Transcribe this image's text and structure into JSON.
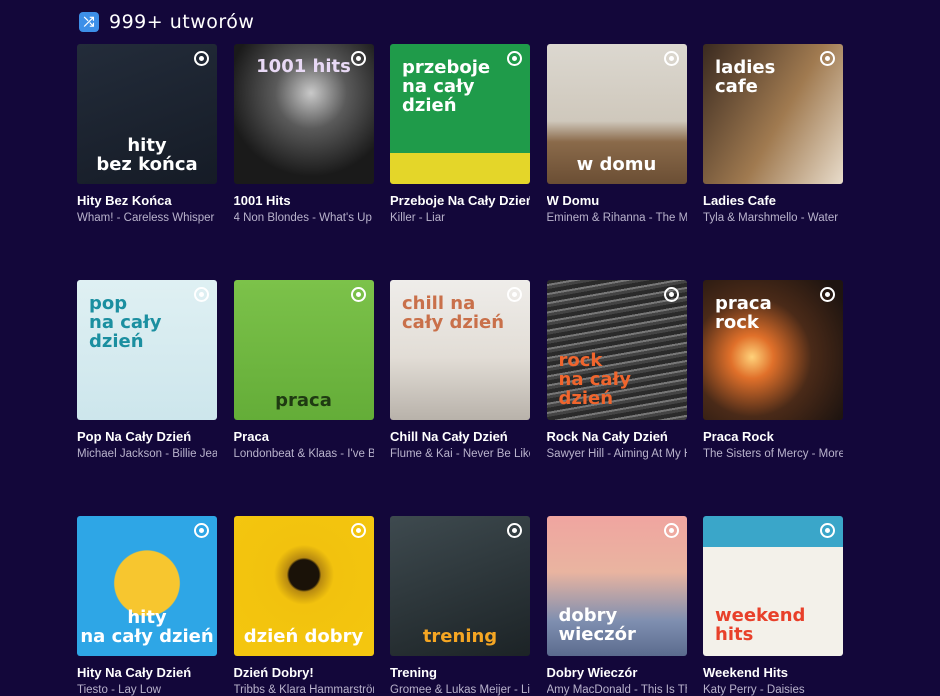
{
  "header": {
    "icon": "shuffle-icon",
    "title": "999+ utworów"
  },
  "playlists": [
    {
      "title": "Hity Bez Końca",
      "subtitle": "Wham! - Careless Whisper",
      "cover_text": "hity\nbez końca",
      "bg": "linear-gradient(160deg,#232c3a,#151b26)",
      "text_color": "#ffffff",
      "pos": "bc"
    },
    {
      "title": "1001 Hits",
      "subtitle": "4 Non Blondes - What's Up",
      "cover_text": "1001 hits",
      "bg": "radial-gradient(circle at 55% 35%,#c9c9c9 0%,#5a5a5a 30%,#1a1a1a 70%)",
      "text_color": "#e8d9f5",
      "pos": "tc"
    },
    {
      "title": "Przeboje Na Cały Dzień",
      "subtitle": "Killer - Liar",
      "cover_text": "przeboje\nna cały\ndzień",
      "bg": "linear-gradient(180deg,#1f9b4a 0%,#1f9b4a 78%,#e4d629 78%)",
      "text_color": "#ffffff",
      "pos": "tl"
    },
    {
      "title": "W Domu",
      "subtitle": "Eminem & Rihanna - The Monster",
      "cover_text": "w domu",
      "bg": "linear-gradient(180deg,#dcd8d0 0%,#cfc8bc 55%,#8a6a4a 70%,#6b4e34 100%)",
      "text_color": "#ffffff",
      "pos": "bc"
    },
    {
      "title": "Ladies Cafe",
      "subtitle": "Tyla & Marshmello - Water",
      "cover_text": "ladies\ncafe",
      "bg": "linear-gradient(120deg,#3a2a20,#a07a50 55%,#e8dccb)",
      "text_color": "#ffffff",
      "pos": "tl"
    },
    {
      "title": "Pop Na Cały Dzień",
      "subtitle": "Michael Jackson - Billie Jean",
      "cover_text": "pop\nna cały\ndzień",
      "bg": "linear-gradient(180deg,#dff0f3,#cde6ec)",
      "text_color": "#1b8fa0",
      "pos": "tl"
    },
    {
      "title": "Praca",
      "subtitle": "Londonbeat & Klaas - I've Been Thinking",
      "cover_text": "praca",
      "bg": "linear-gradient(180deg,#7cc24a,#64ad38)",
      "text_color": "#1f3a12",
      "pos": "bc"
    },
    {
      "title": "Chill Na Cały Dzień",
      "subtitle": "Flume & Kai - Never Be Like You",
      "cover_text": "chill na\ncały dzień",
      "bg": "linear-gradient(180deg,#efedea 0%,#e2ddd6 55%,#b8b2aa 100%)",
      "text_color": "#c9704a",
      "pos": "tl"
    },
    {
      "title": "Rock Na Cały Dzień",
      "subtitle": "Sawyer Hill - Aiming At My Heart",
      "cover_text": "rock\nna cały\ndzień",
      "bg": "repeating-linear-gradient(170deg,#2a2a2a 0 4px,#777 4px 6px,#444 6px 9px)",
      "text_color": "#f0652d",
      "pos": "bl"
    },
    {
      "title": "Praca Rock",
      "subtitle": "The Sisters of Mercy - More",
      "cover_text": "praca\nrock",
      "bg": "radial-gradient(circle at 35% 55%,#ffd27a 0%,#e0702a 18%,#4a2a18 50%,#1e1410 90%)",
      "text_color": "#ffffff",
      "pos": "tl"
    },
    {
      "title": "Hity Na Cały Dzień",
      "subtitle": "Tiesto - Lay Low",
      "cover_text": "hity\nna cały dzień",
      "bg": "radial-gradient(circle at 50% 48%,#f7c62f 0%,#f7c62f 32%,#2ea6e6 33%)",
      "text_color": "#ffffff",
      "pos": "bc"
    },
    {
      "title": "Dzień Dobry!",
      "subtitle": "Tribbs & Klara Hammarström",
      "cover_text": "dzień dobry",
      "bg": "radial-gradient(circle at 50% 42%,#1a1208 0%,#1a1208 14%,#b88a10 16%,#f2c20e 28%,#f4c70f 100%)",
      "text_color": "#ffffff",
      "pos": "bc"
    },
    {
      "title": "Trening",
      "subtitle": "Gromee & Lukas Meijer - Light Me Up",
      "cover_text": "trening",
      "bg": "linear-gradient(160deg,#3e4a4f,#1c2326)",
      "text_color": "#f5a623",
      "pos": "bc"
    },
    {
      "title": "Dobry Wieczór",
      "subtitle": "Amy MacDonald - This Is The Life",
      "cover_text": "dobry\nwieczór",
      "bg": "linear-gradient(180deg,#f0a5a0 0%,#e9b4a0 40%,#7f8fb0 75%,#5b6b8e 100%)",
      "text_color": "#ffffff",
      "pos": "bl"
    },
    {
      "title": "Weekend Hits",
      "subtitle": "Katy Perry - Daisies",
      "cover_text": "weekend\nhits",
      "bg": "linear-gradient(180deg,#3aa6c9 0%,#3aa6c9 22%,#f3f1ea 22%)",
      "text_color": "#e8402a",
      "pos": "bl"
    }
  ]
}
